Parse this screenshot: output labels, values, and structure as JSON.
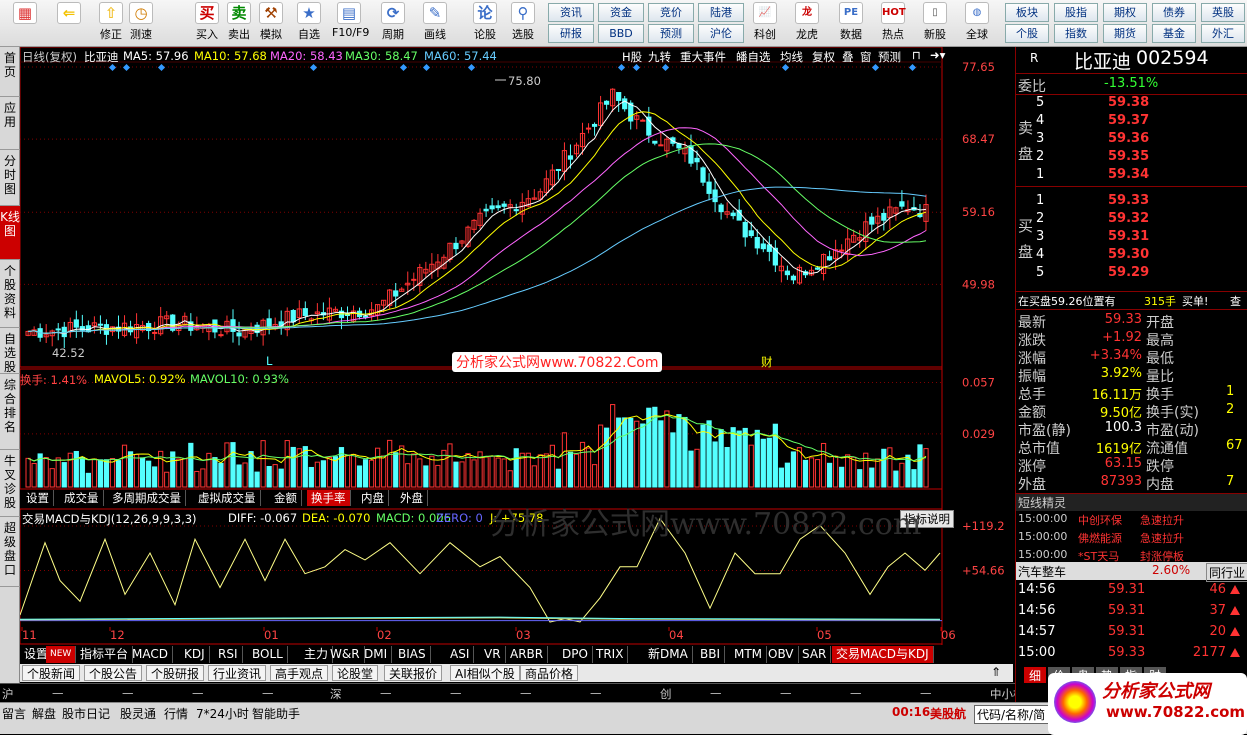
{
  "toolbar": {
    "left_items": [
      {
        "label": "",
        "icon": "grid-icon"
      },
      {
        "label": "",
        "icon": "back-arrow-icon"
      },
      {
        "label": "修正",
        "icon": "up-arrow-icon"
      },
      {
        "label": "测速",
        "icon": "clock-icon"
      },
      {
        "label": "买入",
        "icon": "buy-icon"
      },
      {
        "label": "卖出",
        "icon": "sell-icon"
      },
      {
        "label": "模拟",
        "icon": "hammer-icon"
      },
      {
        "label": "自选",
        "icon": "star-icon"
      },
      {
        "label": "F10/F9",
        "icon": "f10-icon"
      },
      {
        "label": "周期",
        "icon": "cycle-icon"
      },
      {
        "label": "画线",
        "icon": "pen-icon"
      },
      {
        "label": "论股",
        "icon": "chat-icon"
      },
      {
        "label": "选股",
        "icon": "magnify-chart-icon"
      }
    ],
    "grid_buttons_row1": [
      "资讯",
      "资金",
      "竞价",
      "陆港"
    ],
    "grid_buttons_row2": [
      "研报",
      "BBD",
      "预测",
      "沪伦"
    ],
    "right_items": [
      {
        "label": "科创",
        "icon": "trend-icon"
      },
      {
        "label": "龙虎",
        "icon": "dragon-icon"
      },
      {
        "label": "数据",
        "icon": "pe-icon"
      },
      {
        "label": "热点",
        "icon": "hot-icon"
      },
      {
        "label": "新股",
        "icon": "phone-icon"
      },
      {
        "label": "全球",
        "icon": "globe-icon"
      }
    ],
    "right_buttons_row1": [
      "板块",
      "股指",
      "期权",
      "债券",
      "英股"
    ],
    "right_buttons_row2": [
      "个股",
      "指数",
      "期货",
      "基金",
      "外汇"
    ]
  },
  "vtabs": [
    "首页",
    "应用",
    "分时图",
    "K线图",
    "个股资料",
    "自选股",
    "综合排名",
    "牛叉诊股",
    "超级盘口"
  ],
  "kline": {
    "period_label": "日线(复权)",
    "stock_name": "比亚迪",
    "ma": [
      {
        "label": "MA5: 57.96",
        "color": "#ffffff"
      },
      {
        "label": "MA10: 57.68",
        "color": "#ffff00"
      },
      {
        "label": "MA20: 58.43",
        "color": "#ff66ff"
      },
      {
        "label": "MA30: 58.47",
        "color": "#66ff66"
      },
      {
        "label": "MA60: 57.44",
        "color": "#66ccff"
      }
    ],
    "right_tools": [
      "H股",
      "九转",
      "重大事件",
      "皤自选",
      "均线",
      "复权",
      "叠",
      "窗",
      "预测"
    ],
    "y_ticks": [
      "77.65",
      "68.47",
      "59.16",
      "49.98"
    ],
    "high_label": "75.80",
    "low_label": "42.52",
    "markers": [
      "L",
      "财"
    ],
    "watermark": "分析家公式网www.70822.Com"
  },
  "volume": {
    "label_turnover": "换手: 1.41%",
    "label_mavol5": "MAVOL5: 0.92%",
    "label_mavol10": "MAVOL10: 0.93%",
    "y_ticks": [
      "0.057",
      "0.029"
    ],
    "tabs": [
      "设置",
      "成交量",
      "多周期成交量",
      "虚拟成交量",
      "金额",
      "换手率",
      "内盘",
      "外盘"
    ],
    "active_tab": "换手率"
  },
  "indicator": {
    "title": "交易MACD与KDJ(12,26,9,9,3,3)",
    "diff": "DIFF: -0.067",
    "dea": "DEA: -0.070",
    "macd": "MACD: 0.006",
    "zero": "ZERO: 0",
    "j": "J: +75.78",
    "help_button": "指标说明",
    "y_ticks": [
      "+119.2",
      "+54.66"
    ],
    "watermark": "分析家公式网www.70822.com"
  },
  "x_axis": [
    "11",
    "12",
    "01",
    "02",
    "03",
    "04",
    "05",
    "06"
  ],
  "bottom_tabs": [
    "设置",
    "NEW",
    "指标平台",
    "MACD",
    "KDJ",
    "RSI",
    "BOLL",
    "主力",
    "W&R",
    "DMI",
    "BIAS",
    "ASI",
    "VR",
    "ARBR",
    "DPO",
    "TRIX",
    "新DMA",
    "BBI",
    "MTM",
    "OBV",
    "SAR",
    "交易MACD与KDJ"
  ],
  "news_tabs": [
    "个股新闻",
    "个股公告",
    "个股研报",
    "行业资讯",
    "高手观点",
    "论股堂",
    "关联报价",
    "AI相似个股",
    "商品价格"
  ],
  "index_bar": [
    {
      "name": "沪",
      "val": "—"
    },
    {
      "name": "深",
      "val": "—"
    },
    {
      "name": "创",
      "val": "—"
    },
    {
      "name": "中小板指",
      "val": ""
    }
  ],
  "quote": {
    "code_prefix": "R",
    "name": "比亚迪",
    "code": "002594",
    "weibi_label": "委比",
    "weibi": "-13.51%",
    "sell_label": "卖盘",
    "buy_label": "买盘",
    "asks": [
      {
        "lvl": "5",
        "price": "59.38"
      },
      {
        "lvl": "4",
        "price": "59.37"
      },
      {
        "lvl": "3",
        "price": "59.36"
      },
      {
        "lvl": "2",
        "price": "59.35"
      },
      {
        "lvl": "1",
        "price": "59.34"
      }
    ],
    "bids": [
      {
        "lvl": "1",
        "price": "59.33"
      },
      {
        "lvl": "2",
        "price": "59.32"
      },
      {
        "lvl": "3",
        "price": "59.31"
      },
      {
        "lvl": "4",
        "price": "59.30"
      },
      {
        "lvl": "5",
        "price": "59.29"
      }
    ],
    "buy_notice": "在买盘59.26位置有",
    "buy_notice_qty": "315手",
    "buy_notice_tag": "买单!",
    "buy_notice_link": "查",
    "stats": [
      {
        "l": "最新",
        "v": "59.33",
        "c": "#ff3333",
        "l2": "开盘",
        "v2": ""
      },
      {
        "l": "涨跌",
        "v": "+1.92",
        "c": "#ff3333",
        "l2": "最高",
        "v2": ""
      },
      {
        "l": "涨幅",
        "v": "+3.34%",
        "c": "#ff3333",
        "l2": "最低",
        "v2": ""
      },
      {
        "l": "振幅",
        "v": "3.92%",
        "c": "#ffff00",
        "l2": "量比",
        "v2": ""
      },
      {
        "l": "总手",
        "v": "16.11万",
        "c": "#ffff00",
        "l2": "换手",
        "v2": "1"
      },
      {
        "l": "金额",
        "v": "9.50亿",
        "c": "#ffff00",
        "l2": "换手(实)",
        "v2": "2"
      },
      {
        "l": "市盈(静)",
        "v": "100.3",
        "c": "#ffffff",
        "l2": "市盈(动)",
        "v2": ""
      },
      {
        "l": "总市值",
        "v": "1619亿",
        "c": "#ffff00",
        "l2": "流通值",
        "v2": "67"
      },
      {
        "l": "涨停",
        "v": "63.15",
        "c": "#ff3333",
        "l2": "跌停",
        "v2": ""
      },
      {
        "l": "外盘",
        "v": "87393",
        "c": "#ff3333",
        "l2": "内盘",
        "v2": "7"
      }
    ],
    "spirit_title": "短线精灵",
    "spirit": [
      {
        "t": "15:00:00",
        "n": "中创环保",
        "a": "急速拉升"
      },
      {
        "t": "15:00:00",
        "n": "佛燃能源",
        "a": "急速拉升"
      },
      {
        "t": "15:00:00",
        "n": "*ST天马",
        "a": "封涨停板"
      }
    ],
    "industry": "汽车整车",
    "industry_pct": "2.60%",
    "industry_link": "同行业",
    "ticks": [
      {
        "t": "14:56",
        "p": "59.31",
        "q": "46"
      },
      {
        "t": "14:56",
        "p": "59.31",
        "q": "37"
      },
      {
        "t": "14:57",
        "p": "59.31",
        "q": "20"
      },
      {
        "t": "15:00",
        "p": "59.33",
        "q": "2177"
      }
    ],
    "bottom_tabs": [
      "细",
      "价",
      "盘",
      "势",
      "指",
      "财"
    ]
  },
  "status": {
    "items": [
      "留言",
      "解盘",
      "股市日记",
      "股灵通",
      "行情",
      "7*24小时",
      "智能助手"
    ],
    "time": "00:16",
    "market": "美股航",
    "code_hint": "代码/名称/简",
    "logo_text": "分析家公式网",
    "logo_url": "www.70822.com"
  },
  "colors": {
    "up": "#ff3333",
    "down": "#54ffff",
    "bg": "#000000",
    "grid": "#800000",
    "axis": "#c00000"
  }
}
